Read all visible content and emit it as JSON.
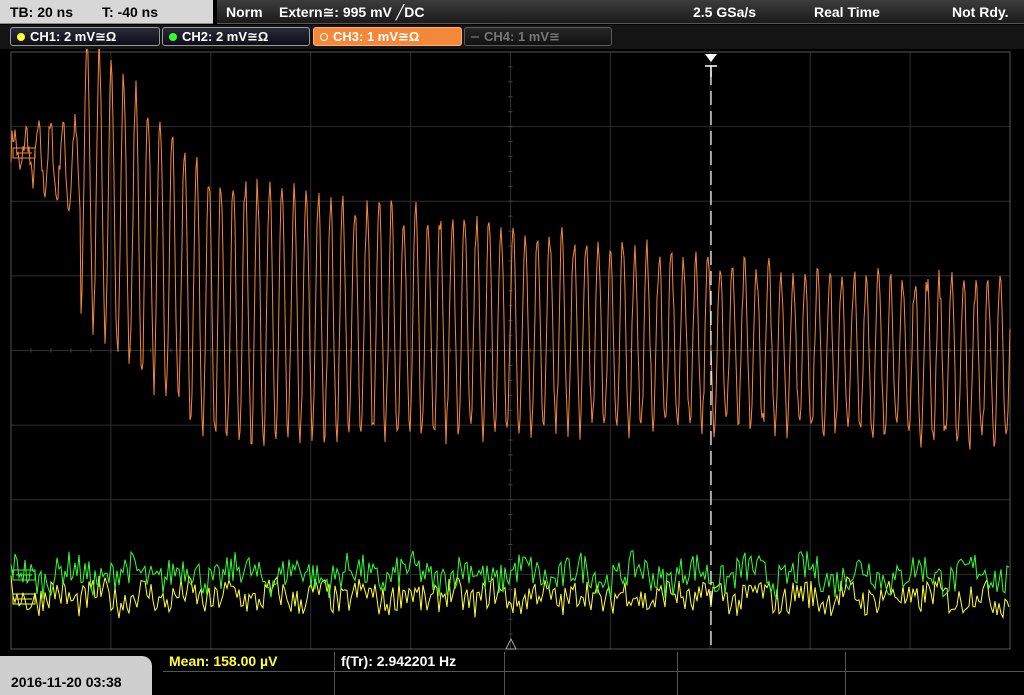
{
  "status": {
    "timebase": "TB: 20 ns",
    "trigger_time": "T: -40 ns",
    "mode": "Norm",
    "trigger_source": "Extern≅: 995 mV ╱DC",
    "sample_rate": "2.5 GSa/s",
    "acq_mode": "Real Time",
    "state": "Not Rdy."
  },
  "channels": [
    {
      "label": "CH1: 2 mV≅Ω",
      "color": "#ffff33",
      "state": "on"
    },
    {
      "label": "CH2: 2 mV≅Ω",
      "color": "#33ff33",
      "state": "on"
    },
    {
      "label": "CH3: 1 mV≅Ω",
      "color": "#f4883a",
      "state": "selected"
    },
    {
      "label": "CH4: 1 mV≅",
      "color": "#777777",
      "state": "off"
    }
  ],
  "measurements": {
    "mean": "Mean: 158.00 µV",
    "freq": "f(Tr): 2.942201 Hz"
  },
  "timestamp": "2016-11-20 03:38",
  "colors": {
    "ch1": "#ffff33",
    "ch2": "#33ff33",
    "ch3": "#f4883a",
    "grid": "#2e2e2e",
    "cursor": "#ffffff"
  },
  "chart_data": {
    "type": "line",
    "grid": true,
    "divisions": {
      "x": 10,
      "y": 8
    },
    "series": [
      {
        "name": "CH3",
        "description": "decaying oscillation",
        "start_level": 2.7,
        "end_level": 0.8
      },
      {
        "name": "CH2",
        "description": "noise",
        "level": -3.0
      },
      {
        "name": "CH1",
        "description": "noise",
        "level": -3.3
      }
    ]
  }
}
